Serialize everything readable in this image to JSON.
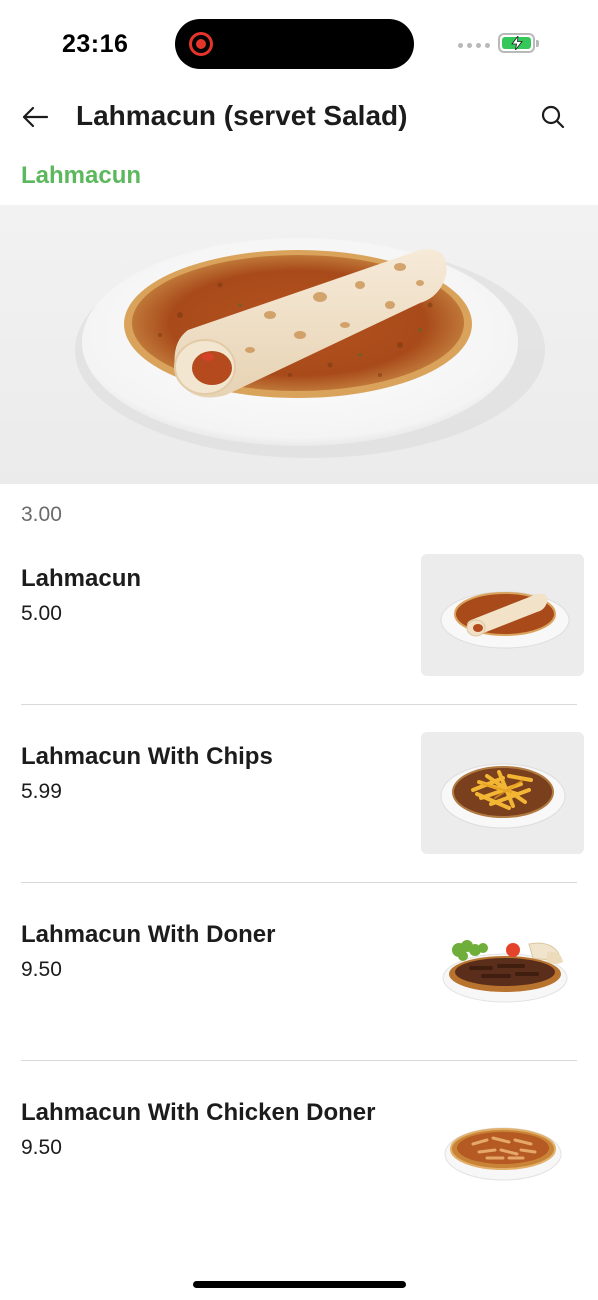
{
  "status_bar": {
    "time": "23:16",
    "battery_level": 1.0,
    "battery_color": "#34c759",
    "recording_color": "#e5342a"
  },
  "header": {
    "title": "Lahmacun (servet Salad)",
    "back_icon": "arrow-left-icon",
    "search_icon": "search-icon"
  },
  "category": {
    "label": "Lahmacun",
    "color": "#5cb85c",
    "base_price": "3.00"
  },
  "items": [
    {
      "name": "Lahmacun",
      "price": "5.00",
      "image": "lahmacun-wrap-plate"
    },
    {
      "name": "Lahmacun With Chips",
      "price": "5.99",
      "image": "lahmacun-chips-plate"
    },
    {
      "name": "Lahmacun With Doner",
      "price": "9.50",
      "image": "lahmacun-doner-plate"
    },
    {
      "name": "Lahmacun With Chicken Doner",
      "price": "9.50",
      "image": "lahmacun-chicken-doner-plate"
    }
  ]
}
